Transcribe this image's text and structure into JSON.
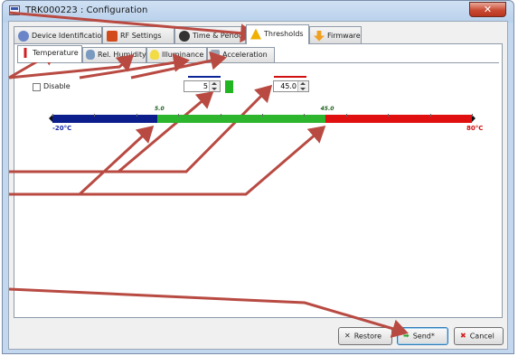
{
  "window": {
    "title": "TRK000223 : Configuration",
    "close_glyph": "✕"
  },
  "main_tabs": [
    {
      "label": "Device Identification",
      "icon": "device-icon",
      "selected": false
    },
    {
      "label": "RF Settings",
      "icon": "rf-antenna-icon",
      "selected": false
    },
    {
      "label": "Time & Period",
      "icon": "clock-icon",
      "selected": false
    },
    {
      "label": "Thresholds",
      "icon": "warning-icon",
      "selected": true
    },
    {
      "label": "Firmware",
      "icon": "download-icon",
      "selected": false
    }
  ],
  "sub_tabs": [
    {
      "label": "Temperature",
      "icon": "thermometer-icon",
      "selected": true
    },
    {
      "label": "Rel. Humidity",
      "icon": "humidity-icon",
      "selected": false
    },
    {
      "label": "Illuminance",
      "icon": "lightbulb-icon",
      "selected": false
    },
    {
      "label": "Acceleration",
      "icon": "acceleration-icon",
      "selected": false
    }
  ],
  "temperature": {
    "disable_label": "Disable",
    "disable_checked": false,
    "low_threshold_value": "5",
    "high_threshold_value": "45.0",
    "range_min_label": "-20°C",
    "range_max_label": "80°C",
    "low_marker_label": "5.0",
    "high_marker_label": "45.0",
    "range_min": -20,
    "range_max": 80,
    "low_threshold": 5,
    "high_threshold": 45,
    "colors": {
      "low": "#0c1d8c",
      "normal": "#2db52d",
      "high": "#e01010",
      "low_line": "#0b2496",
      "high_line": "#d01010"
    }
  },
  "buttons": {
    "restore": "Restore",
    "send": "Send*",
    "cancel": "Cancel"
  },
  "annotation_color": "#b84a42"
}
